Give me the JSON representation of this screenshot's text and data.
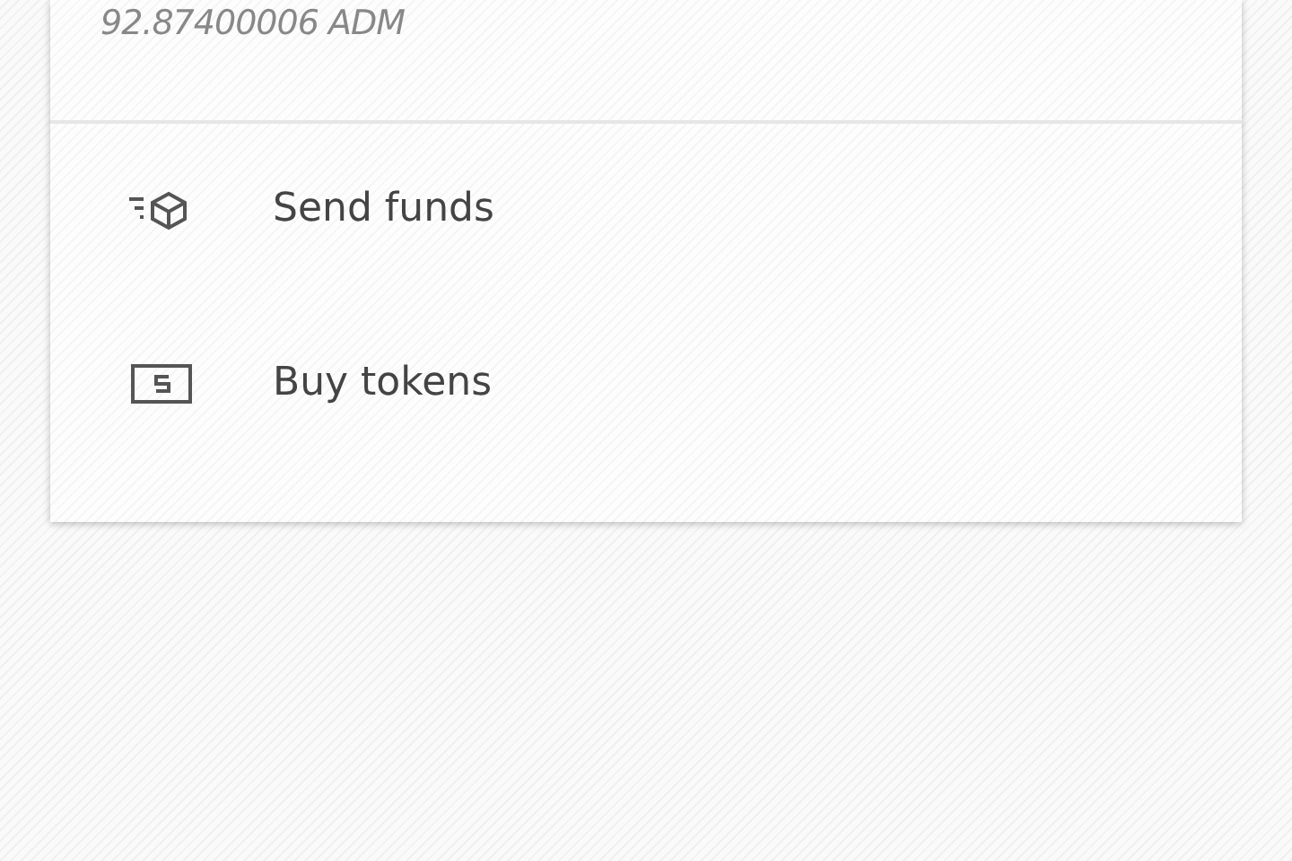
{
  "balance": {
    "amount": "92.87400006 ADM"
  },
  "actions": [
    {
      "kind": "send",
      "label": "Send funds"
    },
    {
      "kind": "buy",
      "label": "Buy tokens"
    }
  ]
}
